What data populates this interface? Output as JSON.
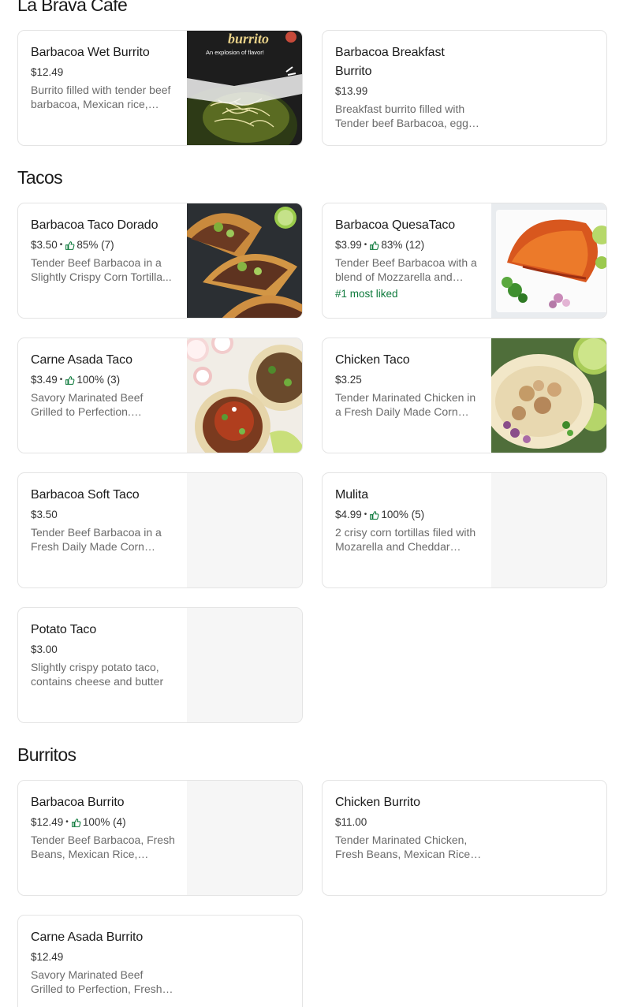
{
  "restaurant_title": "La Brava Cafe",
  "sections": [
    {
      "title": "Tacos"
    },
    {
      "title": "Burritos"
    }
  ],
  "items": {
    "wet_burrito": {
      "name": "Barbacoa Wet Burrito",
      "price": "$12.49",
      "desc": "Burrito filled with tender beef barbacoa, Mexican rice, beans and cheese",
      "image_text_1": "burrito",
      "image_text_2": "An explosion of flavor!"
    },
    "breakfast_burrito": {
      "name": "Barbacoa Breakfast Burrito",
      "price": "$13.99",
      "desc": "Breakfast burrito filled with Tender beef Barbacoa, eggs and potatoes"
    },
    "taco_dorado": {
      "name": "Barbacoa Taco Dorado",
      "price": "$3.50",
      "rating": "85% (7)",
      "desc": "Tender Beef Barbacoa in a Slightly Crispy Corn Tortilla..."
    },
    "quesataco": {
      "name": "Barbacoa QuesaTaco",
      "price": "$3.99",
      "rating": "83% (12)",
      "desc": "Tender Beef Barbacoa with a blend of Mozzarella and Cheddar cheese",
      "badge": "#1 most liked"
    },
    "carne_asada_taco": {
      "name": "Carne Asada Taco",
      "price": "$3.49",
      "rating": "100% (3)",
      "desc": "Savory Marinated Beef Grilled to Perfection. Served..."
    },
    "chicken_taco": {
      "name": "Chicken Taco",
      "price": "$3.25",
      "desc": "Tender Marinated Chicken in a Fresh Daily Made Corn Tortilla"
    },
    "soft_taco": {
      "name": "Barbacoa Soft Taco",
      "price": "$3.50",
      "desc": "Tender Beef Barbacoa in a Fresh Daily Made Corn Tortilla"
    },
    "mulita": {
      "name": "Mulita",
      "price": "$4.99",
      "rating": "100% (5)",
      "desc": "2 crisy corn tortillas filed with Mozarella and Cheddar cheese"
    },
    "potato_taco": {
      "name": "Potato Taco",
      "price": "$3.00",
      "desc": "Slightly crispy potato taco, contains cheese and butter"
    },
    "barbacoa_burrito": {
      "name": "Barbacoa Burrito",
      "price": "$12.49",
      "rating": "100% (4)",
      "desc": "Tender Beef Barbacoa, Fresh Beans, Mexican Rice, Cheese"
    },
    "chicken_burrito": {
      "name": "Chicken Burrito",
      "price": "$11.00",
      "desc": "Tender Marinated Chicken, Fresh Beans, Mexican Rice, Cheese"
    },
    "carne_asada_burrito": {
      "name": "Carne Asada Burrito",
      "price": "$12.49",
      "desc": "Savory Marinated Beef Grilled to Perfection, Fresh Beans"
    }
  },
  "colors": {
    "accent_green": "#0e7a3c",
    "border": "#e4e4e4",
    "text_muted": "#6b6b6b"
  },
  "icons": {
    "rating": "thumbs-up-icon"
  }
}
